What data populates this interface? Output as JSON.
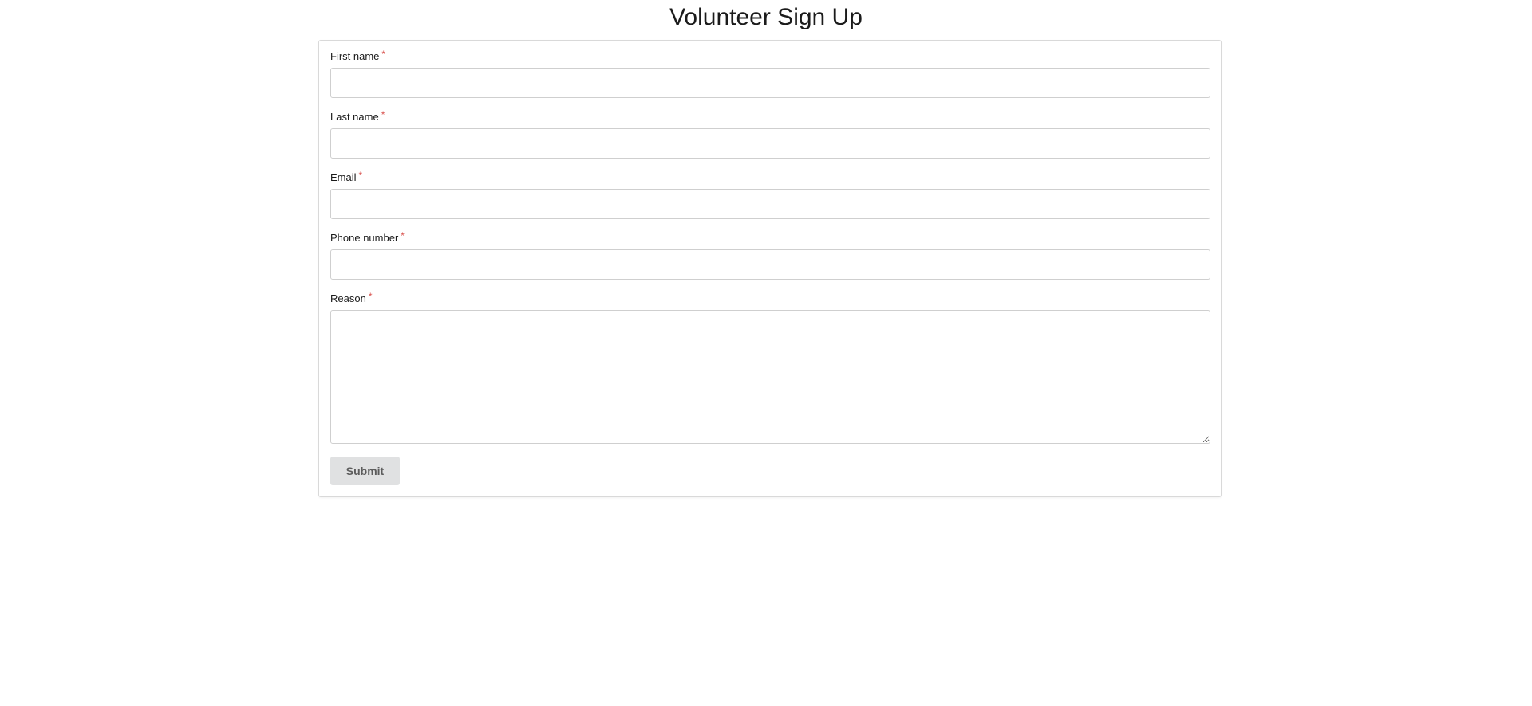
{
  "page": {
    "title": "Volunteer Sign Up"
  },
  "form": {
    "fields": [
      {
        "label": "First name",
        "required_mark": "*",
        "value": "",
        "placeholder": ""
      },
      {
        "label": "Last name",
        "required_mark": "*",
        "value": "",
        "placeholder": ""
      },
      {
        "label": "Email",
        "required_mark": "*",
        "value": "",
        "placeholder": ""
      },
      {
        "label": "Phone number",
        "required_mark": "*",
        "value": "",
        "placeholder": ""
      },
      {
        "label": "Reason",
        "required_mark": "*",
        "value": "",
        "placeholder": ""
      }
    ],
    "submit_label": "Submit"
  },
  "colors": {
    "required_mark": "#d9534f",
    "submit_background": "#e0e1e2",
    "submit_text": "#5c5c5c",
    "border": "#cfcfcf"
  }
}
